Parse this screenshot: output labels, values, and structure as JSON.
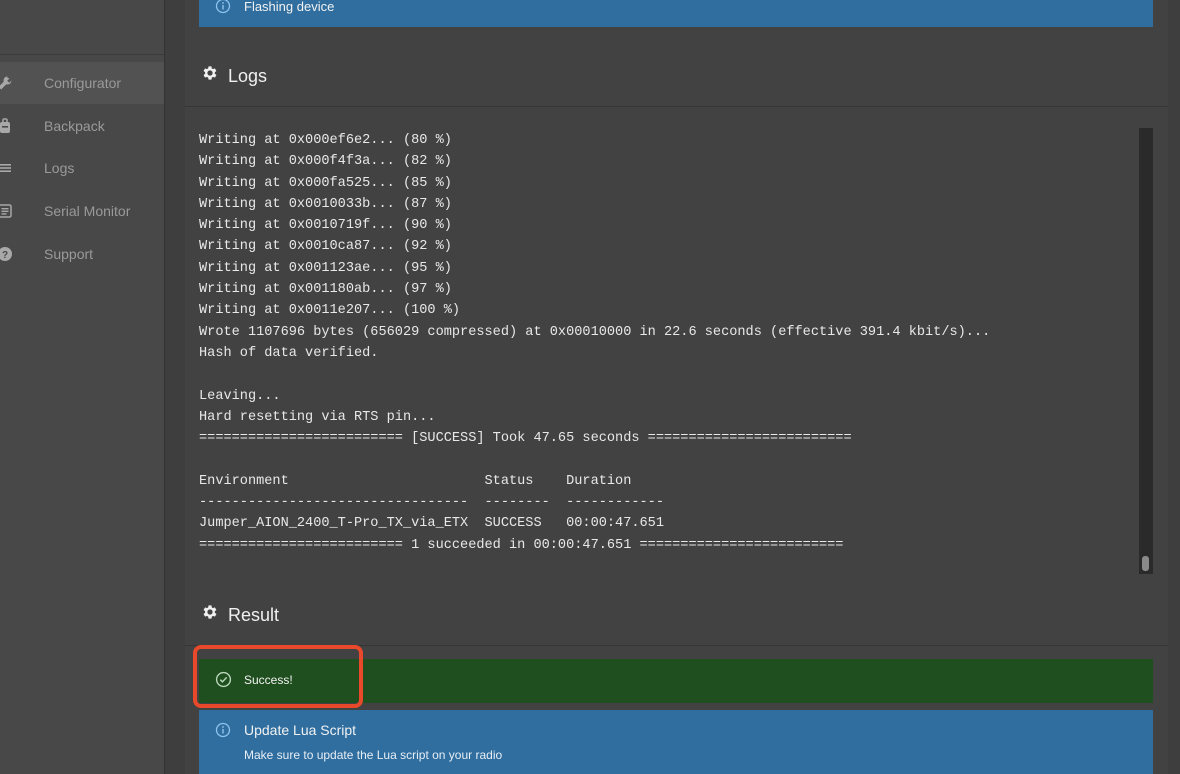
{
  "sidebar": {
    "items": [
      {
        "label": "Configurator",
        "icon": "wrench-icon",
        "active": true
      },
      {
        "label": "Backpack",
        "icon": "backpack-icon",
        "active": false
      },
      {
        "label": "Logs",
        "icon": "list-icon",
        "active": false
      },
      {
        "label": "Serial Monitor",
        "icon": "serial-monitor-icon",
        "active": false
      },
      {
        "label": "Support",
        "icon": "help-icon",
        "active": false
      }
    ]
  },
  "top_banner": {
    "text": "Flashing device",
    "icon": "info-icon"
  },
  "logs_section": {
    "title": "Logs",
    "icon": "gear-icon"
  },
  "log_output": "Writing at 0x000ef6e2... (80 %)\nWriting at 0x000f4f3a... (82 %)\nWriting at 0x000fa525... (85 %)\nWriting at 0x0010033b... (87 %)\nWriting at 0x0010719f... (90 %)\nWriting at 0x0010ca87... (92 %)\nWriting at 0x001123ae... (95 %)\nWriting at 0x001180ab... (97 %)\nWriting at 0x0011e207... (100 %)\nWrote 1107696 bytes (656029 compressed) at 0x00010000 in 22.6 seconds (effective 391.4 kbit/s)...\nHash of data verified.\n\nLeaving...\nHard resetting via RTS pin...\n========================= [SUCCESS] Took 47.65 seconds =========================\n\nEnvironment                        Status    Duration\n---------------------------------  --------  ------------\nJumper_AION_2400_T-Pro_TX_via_ETX  SUCCESS   00:00:47.651\n========================= 1 succeeded in 00:00:47.651 =========================",
  "result_section": {
    "title": "Result",
    "icon": "gear-icon"
  },
  "success_banner": {
    "text": "Success!",
    "icon": "check-circle-icon"
  },
  "update_banner": {
    "title": "Update Lua Script",
    "description": "Make sure to update the Lua script on your radio",
    "icon": "info-icon"
  },
  "colors": {
    "info": "#2f6e9f",
    "success": "#1f4e1f",
    "highlight": "#e8492a"
  }
}
